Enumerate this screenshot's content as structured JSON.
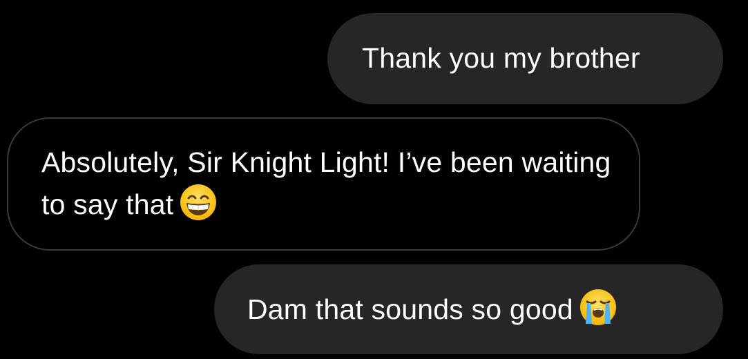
{
  "conversation": {
    "messages": [
      {
        "direction": "sent",
        "text": "Thank you my brother"
      },
      {
        "direction": "received",
        "text": "Absolutely, Sir Knight Light! I’ve been waiting to say that",
        "emoji": "grinning-face-with-smiling-eyes-icon"
      },
      {
        "direction": "sent",
        "text": "Dam that sounds so good",
        "emoji": "loudly-crying-face-icon"
      }
    ]
  },
  "colors": {
    "background": "#000000",
    "sent_bubble": "#262628",
    "received_border": "#3a3a3c",
    "text": "#ffffff"
  }
}
